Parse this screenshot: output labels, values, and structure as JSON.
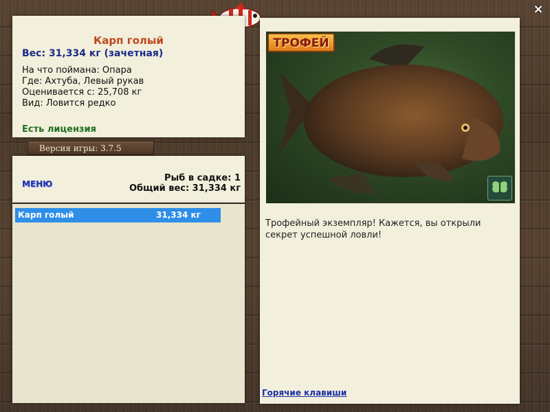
{
  "catch": {
    "fish_name": "Карп голый",
    "weight_line": "Вес: 31,334 кг (зачетная)",
    "bait_line": "На что поймана: Опара",
    "location_line": "Где: Ахтуба, Левый рукав",
    "valued_line": "Оценивается с: 25,708 кг",
    "kind_line": "Вид: Ловится редко",
    "license": "Есть лицензия"
  },
  "version": "Версия игры: 3.7.5",
  "cage": {
    "menu_label": "МЕНЮ",
    "count_line": "Рыб в садке: 1",
    "total_line": "Общий вес: 31,334 кг",
    "rows": [
      {
        "name": "Карп голый",
        "weight": "31,334 кг"
      }
    ]
  },
  "trophy": {
    "badge": "ТРОФЕЙ",
    "description": "Трофейный экземпляр! Кажется, вы открыли секрет успешной ловли!",
    "hotkeys_link": "Горячие клавиши"
  },
  "window": {
    "close_symbol": "×"
  },
  "colors": {
    "fish_name": "#c0461c",
    "weight": "#1a2a8a",
    "license": "#1e6e1e",
    "selected_row": "#2e8ee8",
    "link": "#1c30a8"
  }
}
